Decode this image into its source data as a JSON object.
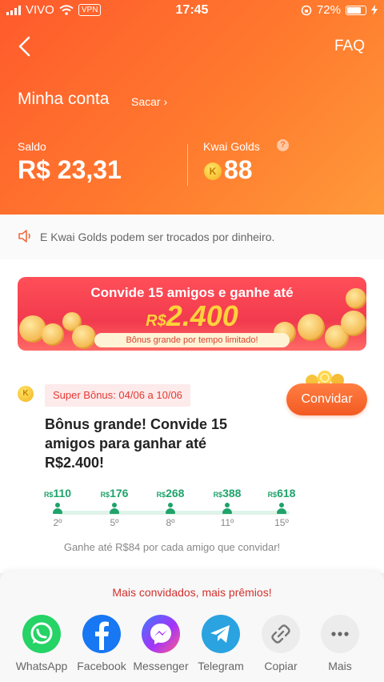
{
  "status_bar": {
    "carrier": "VIVO",
    "vpn": "VPN",
    "time": "17:45",
    "battery": "72%"
  },
  "header": {
    "faq": "FAQ",
    "title": "Minha conta",
    "sacar": "Sacar ›",
    "balance": {
      "label": "Saldo",
      "value": "R$ 23,31"
    },
    "gold": {
      "label": "Kwai Golds",
      "help": "?",
      "coin": "K",
      "value": "88"
    }
  },
  "notice": {
    "text": "E Kwai Golds podem ser trocados por dinheiro."
  },
  "banner": {
    "title": "Convide 15 amigos e ganhe até",
    "currency": "R$",
    "amount": "2.400",
    "subtitle": "Bônus grande por tempo limitado!"
  },
  "super_bonus": {
    "coin": "K",
    "tag": "Super Bônus: 04/06 a 10/06",
    "button": "Convidar",
    "description": "Bônus grande! Convide 15 amigos para ganhar até R$2.400!"
  },
  "milestones": [
    {
      "currency": "R$",
      "value": "110",
      "label": "2º"
    },
    {
      "currency": "R$",
      "value": "176",
      "label": "5º"
    },
    {
      "currency": "R$",
      "value": "268",
      "label": "8º"
    },
    {
      "currency": "R$",
      "value": "388",
      "label": "11º"
    },
    {
      "currency": "R$",
      "value": "618",
      "label": "15º"
    }
  ],
  "per_friend_text": "Ganhe até R$84 por cada amigo que convidar!",
  "share_sheet": {
    "title": "Mais convidados, mais prêmios!",
    "items": [
      {
        "label": "WhatsApp",
        "icon": "whatsapp-icon",
        "color": "#25d366"
      },
      {
        "label": "Facebook",
        "icon": "facebook-icon",
        "color": "#1877f2"
      },
      {
        "label": "Messenger",
        "icon": "messenger-icon",
        "color": "#a334fa"
      },
      {
        "label": "Telegram",
        "icon": "telegram-icon",
        "color": "#2aa3e0"
      },
      {
        "label": "Copiar",
        "icon": "link-icon",
        "color": "#ececec"
      },
      {
        "label": "Mais",
        "icon": "more-icon",
        "color": "#ececec"
      }
    ]
  }
}
